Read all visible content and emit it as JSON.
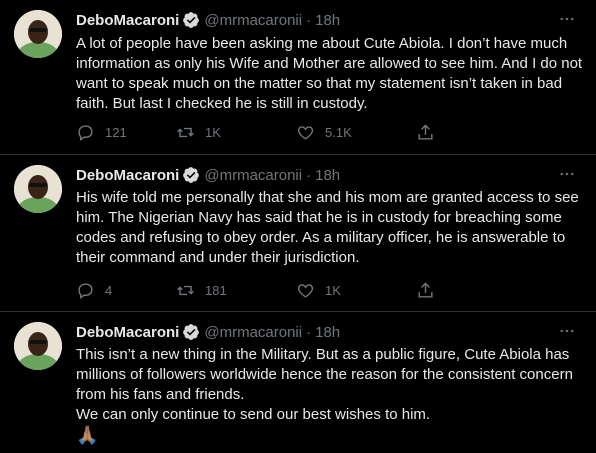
{
  "tweets": [
    {
      "name": "DeboMacaroni",
      "handle": "@mrmacaronii",
      "dot": "·",
      "time": "18h",
      "text": "A lot of people have been asking me about Cute Abiola. I don’t have much information as only his Wife and Mother are allowed to see him. And I do not want to speak much on the matter so that my statement isn’t taken in bad faith. But last I checked he is still in custody.",
      "replies": "121",
      "retweets": "1K",
      "likes": "5.1K"
    },
    {
      "name": "DeboMacaroni",
      "handle": "@mrmacaronii",
      "dot": "·",
      "time": "18h",
      "text": "His wife told me personally that she and his mom are granted access to see him. The Nigerian Navy has said that he is in custody for breaching some codes and refusing to obey order. As a military officer, he is answerable to their command and under their jurisdiction.",
      "replies": "4",
      "retweets": "181",
      "likes": "1K"
    },
    {
      "name": "DeboMacaroni",
      "handle": "@mrmacaronii",
      "dot": "·",
      "time": "18h",
      "text_line1": "This isn’t a new thing in the Military. But as a public figure, Cute Abiola has millions of followers worldwide hence the reason for the consistent concern from his fans and friends.",
      "text_line2": "We can only continue to send our best wishes to him.",
      "emoji": "🙏🏽"
    }
  ],
  "icons": {
    "verified": "verified-badge-icon",
    "more": "more-options-icon",
    "reply": "reply-icon",
    "retweet": "retweet-icon",
    "like": "like-icon",
    "share": "share-icon"
  },
  "colors": {
    "background": "#000000",
    "text": "#e7e9ea",
    "secondary": "#71767b",
    "verified": "#1d9bf0"
  }
}
